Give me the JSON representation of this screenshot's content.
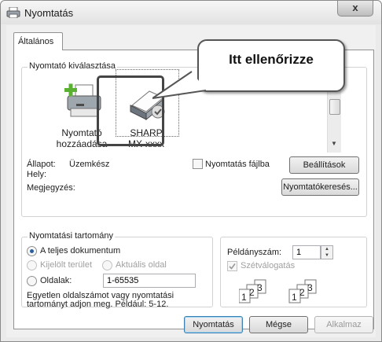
{
  "window": {
    "title": "Nyomtatás",
    "close": "x"
  },
  "tab": {
    "label": "Általános"
  },
  "printer_group": {
    "title": "Nyomtató kiválasztása",
    "add_printer": [
      "Nyomtató",
      "hozzáadása"
    ],
    "selected_printer": [
      "SHARP",
      "MX-xxxx"
    ]
  },
  "status": {
    "state_label": "Állapot:",
    "state_value": "Üzemkész",
    "location_label": "Hely:",
    "comment_label": "Megjegyzés:",
    "print_to_file": "Nyomtatás fájlba",
    "preferences": "Beállítások",
    "find_printer": "Nyomtatókeresés..."
  },
  "range_group": {
    "title": "Nyomtatási tartomány",
    "all": "A teljes dokumentum",
    "selection": "Kijelölt terület",
    "current": "Aktuális oldal",
    "pages": "Oldalak:",
    "pages_value": "1-65535",
    "hint_line1": "Egyetlen oldalszámot vagy nyomtatási",
    "hint_line2": "tartományt adjon meg. Például: 5-12."
  },
  "copies": {
    "label": "Példányszám:",
    "value": "1",
    "collate": "Szétválogatás"
  },
  "collate_icon": {
    "digits": [
      "1",
      "2",
      "3"
    ]
  },
  "footer": {
    "print": "Nyomtatás",
    "cancel": "Mégse",
    "apply": "Alkalmaz"
  },
  "callout": {
    "text": "Itt ellenőrizze"
  },
  "icons": {
    "app": "printer-icon",
    "add_printer": "add-printer-icon",
    "selected_printer": "printer-check-icon",
    "collate": "collate-pages-icon"
  }
}
